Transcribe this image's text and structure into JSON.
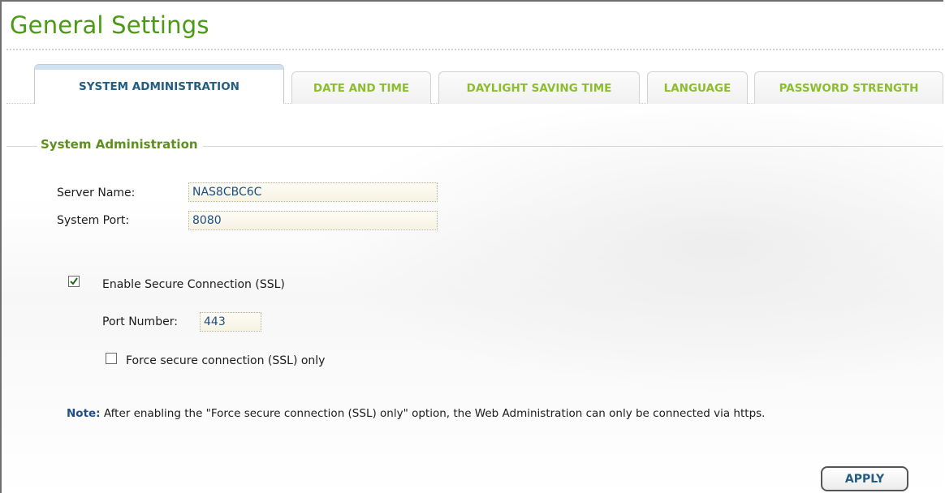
{
  "page": {
    "title": "General Settings"
  },
  "tabs": [
    {
      "label": "SYSTEM ADMINISTRATION",
      "active": true
    },
    {
      "label": "DATE AND TIME",
      "active": false
    },
    {
      "label": "DAYLIGHT SAVING TIME",
      "active": false
    },
    {
      "label": "LANGUAGE",
      "active": false
    },
    {
      "label": "PASSWORD STRENGTH",
      "active": false
    }
  ],
  "section": {
    "title": "System Administration"
  },
  "form": {
    "server_name_label": "Server Name:",
    "server_name_value": "NAS8CBC6C",
    "system_port_label": "System Port:",
    "system_port_value": "8080",
    "ssl_label": "Enable Secure Connection (SSL)",
    "ssl_checked": true,
    "port_number_label": "Port Number:",
    "port_number_value": "443",
    "force_ssl_label": "Force secure connection (SSL) only",
    "force_ssl_checked": false
  },
  "note": {
    "label": "Note:",
    "text": "After enabling the \"Force secure connection (SSL) only\" option, the Web Administration can only be connected via https."
  },
  "actions": {
    "apply_label": "APPLY"
  },
  "colors": {
    "title": "#4a9a14",
    "tab_inactive": "#8dbd2f",
    "tab_active": "#235e80",
    "section_title": "#5e8f1f",
    "field_text": "#1b4e85"
  }
}
